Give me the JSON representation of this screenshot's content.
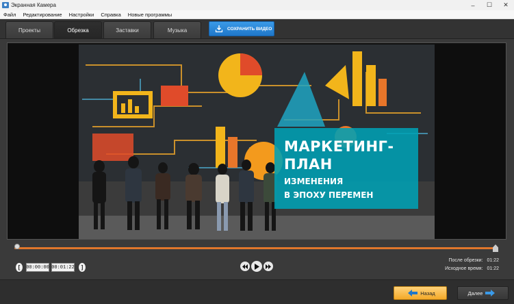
{
  "window": {
    "title": "Экранная Камера"
  },
  "menu": {
    "items": [
      "Файл",
      "Редактирование",
      "Настройки",
      "Справка",
      "Новые программы"
    ]
  },
  "tabs": [
    {
      "label": "Проекты"
    },
    {
      "label": "Обрезка"
    },
    {
      "label": "Заставки"
    },
    {
      "label": "Музыка"
    }
  ],
  "active_tab": "Обрезка",
  "save_button": {
    "label": "СОХРАНИТЬ ВИДЕО"
  },
  "video": {
    "title_line1": "МАРКЕТИНГ-",
    "title_line2": "ПЛАН",
    "subtitle_line1": "ИЗМЕНЕНИЯ",
    "subtitle_line2": "В ЭПОХУ ПЕРЕМЕН"
  },
  "trim": {
    "start_time": "00:00:00",
    "end_time": "00:01:22",
    "start_marker": "[",
    "end_marker": "]"
  },
  "info": {
    "after_trim_label": "После обрезки:",
    "after_trim_value": "01:22",
    "source_label": "Исходное время:",
    "source_value": "01:22"
  },
  "nav": {
    "back_label": "Назад",
    "next_label": "Далее"
  },
  "colors": {
    "accent": "#e0762b",
    "save": "#2a87d8",
    "back": "#f4a928",
    "overlay": "#00a0b4"
  }
}
